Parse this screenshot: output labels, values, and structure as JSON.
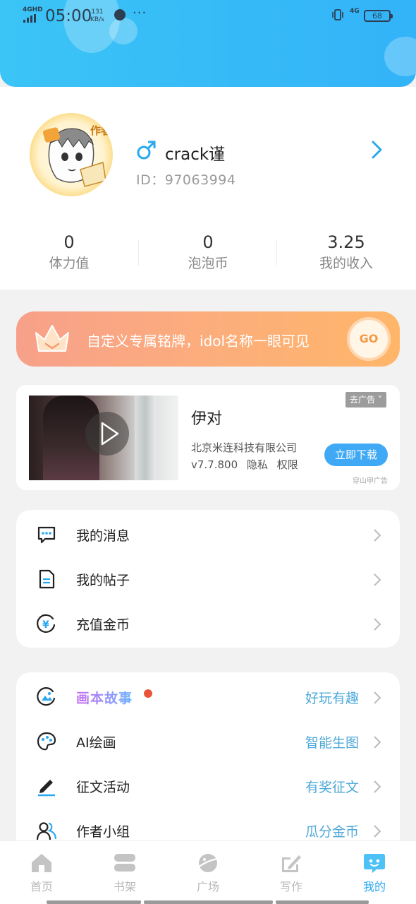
{
  "status_bar": {
    "network": "4GHD",
    "time": "05:00",
    "speed_value": "131",
    "speed_unit": "KB/s",
    "more": "···",
    "network_right": "4G",
    "battery": "68"
  },
  "profile": {
    "gender_icon": "male-symbol",
    "username": "crack谨",
    "id_label": "ID：97063994",
    "avatar_badge": "作者"
  },
  "stats": [
    {
      "value": "0",
      "label": "体力值"
    },
    {
      "value": "0",
      "label": "泡泡币"
    },
    {
      "value": "3.25",
      "label": "我的收入"
    }
  ],
  "banner": {
    "text": "自定义专属铭牌，idol名称一眼可见",
    "button": "GO"
  },
  "ad": {
    "title": "伊对",
    "company": "北京米连科技有限公司",
    "version": "v7.7.800",
    "privacy": "隐私",
    "permissions": "权限",
    "close_label": "去广告 ˅",
    "download": "立即下载",
    "source": "穿山甲广告"
  },
  "menu1": [
    {
      "label": "我的消息",
      "icon": "message-icon"
    },
    {
      "label": "我的帖子",
      "icon": "document-icon"
    },
    {
      "label": "充值金币",
      "icon": "yuan-coin-icon"
    }
  ],
  "menu2": [
    {
      "label": "画本故事",
      "tag": "好玩有趣",
      "icon": "picture-book-icon"
    },
    {
      "label": "AI绘画",
      "tag": "智能生图",
      "icon": "palette-icon"
    },
    {
      "label": "征文活动",
      "tag": "有奖征文",
      "icon": "pen-icon"
    },
    {
      "label": "作者小组",
      "tag": "瓜分金币",
      "icon": "group-icon"
    }
  ],
  "tabbar": [
    {
      "label": "首页",
      "icon": "home-icon"
    },
    {
      "label": "书架",
      "icon": "bookshelf-icon"
    },
    {
      "label": "广场",
      "icon": "planet-icon"
    },
    {
      "label": "写作",
      "icon": "write-icon"
    },
    {
      "label": "我的",
      "icon": "profile-chat-icon",
      "active": true
    }
  ],
  "colors": {
    "header_blue": "#33b3f8",
    "accent_blue": "#2aa8ef",
    "tag_blue": "#4da8d8",
    "banner_orange": "#ffb669",
    "red_dot": "#e8563a"
  }
}
